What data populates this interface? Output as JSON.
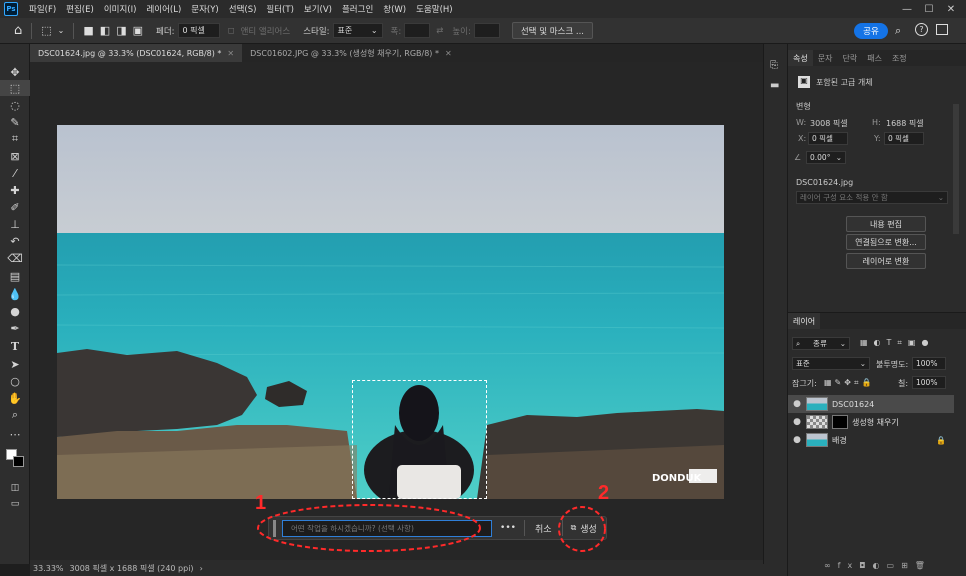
{
  "app": {
    "logo": "Ps"
  },
  "menu": [
    "파일(F)",
    "편집(E)",
    "이미지(I)",
    "레이어(L)",
    "문자(Y)",
    "선택(S)",
    "필터(T)",
    "보기(V)",
    "플러그인",
    "창(W)",
    "도움말(H)"
  ],
  "window_controls": {
    "minimize": "—",
    "maximize": "☐",
    "close": "✕"
  },
  "options": {
    "feather_label": "페더:",
    "feather_value": "0 픽셀",
    "antialias_label": "앤티 앨리어스",
    "style_label": "스타일:",
    "style_value": "표준",
    "width_label": "폭:",
    "height_label": "높이:",
    "select_mask_label": "선택 및 마스크 ...",
    "share_label": "공유"
  },
  "tabs": [
    {
      "label": "DSC01624.jpg @ 33.3% (DSC01624, RGB/8) *",
      "active": true
    },
    {
      "label": "DSC01602.JPG @ 33.3% (생성형 채우기, RGB/8) *",
      "active": false
    }
  ],
  "tools": [
    "move-tool-icon",
    "marquee-tool-icon",
    "lasso-tool-icon",
    "quick-select-tool-icon",
    "crop-tool-icon",
    "frame-tool-icon",
    "eyedropper-tool-icon",
    "healing-brush-icon",
    "brush-tool-icon",
    "stamp-tool-icon",
    "history-brush-icon",
    "eraser-tool-icon",
    "gradient-tool-icon",
    "blur-tool-icon",
    "dodge-tool-icon",
    "pen-tool-icon",
    "type-tool-icon",
    "path-select-icon",
    "rectangle-tool-icon",
    "hand-tool-icon",
    "zoom-tool-icon",
    "more-tools-icon"
  ],
  "watermark": "DONDUK",
  "context_bar": {
    "prompt_placeholder": "어떤 작업을 하시겠습니까? (선택 사항)",
    "more": "•••",
    "cancel": "취소",
    "generate": "생성"
  },
  "annotations": {
    "one": "1",
    "two": "2"
  },
  "status": {
    "zoom": "33.33%",
    "doc_info": "3008 픽셀 x 1688 픽셀 (240 ppi)"
  },
  "properties": {
    "tabs": [
      "속성",
      "문자",
      "단락",
      "패스",
      "조정"
    ],
    "object_type": "포함된 고급 개체",
    "transform_label": "변형",
    "w_label": "W:",
    "w_value": "3008 픽셀",
    "h_label": "H:",
    "h_value": "1688 픽셀",
    "x_label": "X:",
    "x_value": "0 픽셀",
    "y_label": "Y:",
    "y_value": "0 픽셀",
    "angle_value": "0.00°",
    "file_name": "DSC01624.jpg",
    "layer_comp": "레이어 구성 요소 적용 안 함",
    "edit_contents": "내용 편집",
    "convert_linked": "연결됨으로 변환...",
    "convert_layers": "레이어로 변환"
  },
  "layers_panel": {
    "title": "레이어",
    "filter": "종류",
    "blend_mode": "표준",
    "opacity_label": "불투명도:",
    "opacity_value": "100%",
    "lock_label": "잠그기:",
    "fill_label": "칠:",
    "fill_value": "100%",
    "layers": [
      {
        "name": "DSC01624",
        "selected": true
      },
      {
        "name": "생성형 채우기",
        "selected": false
      },
      {
        "name": "배경",
        "selected": false
      }
    ]
  },
  "colors": {
    "accent": "#1473e6",
    "annotation": "#ff2a2a",
    "bg": "#1e1e1e"
  }
}
